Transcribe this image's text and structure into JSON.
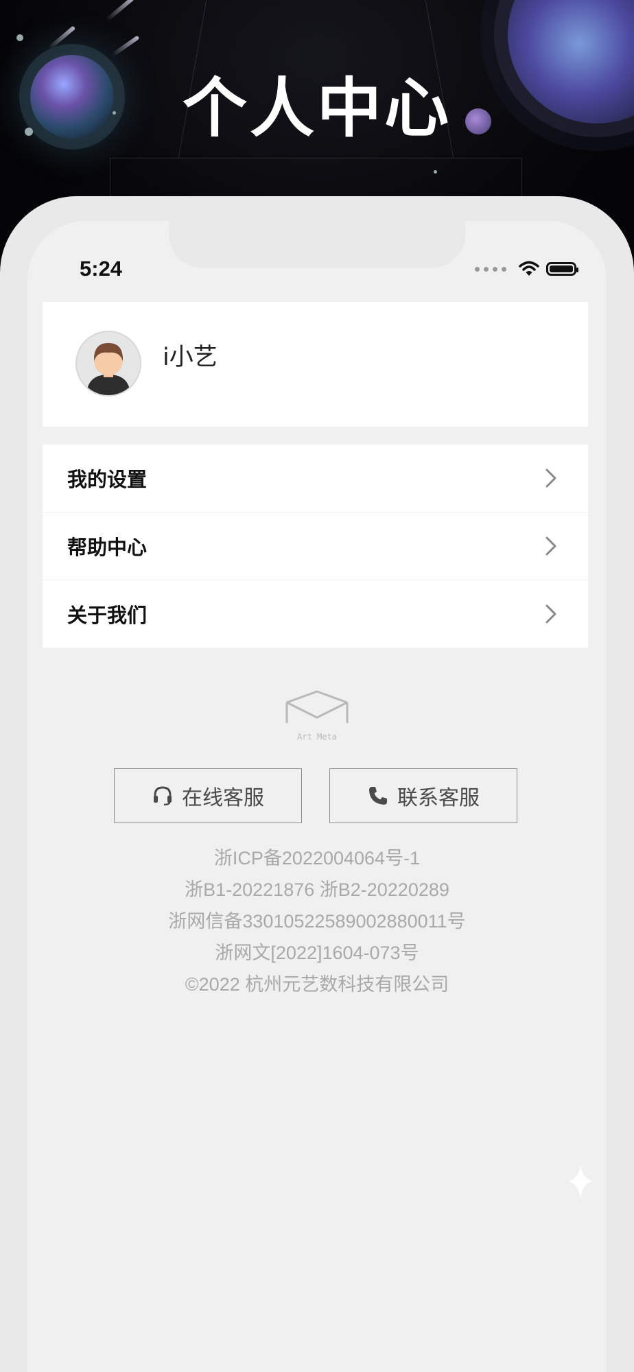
{
  "banner": {
    "title": "个人中心"
  },
  "status_bar": {
    "time": "5:24"
  },
  "profile": {
    "username": "i小艺"
  },
  "menu": {
    "items": [
      {
        "label": "我的设置"
      },
      {
        "label": "帮助中心"
      },
      {
        "label": "关于我们"
      }
    ]
  },
  "logo": {
    "text": "Art Meta"
  },
  "buttons": {
    "online_service": "在线客服",
    "contact_service": "联系客服"
  },
  "footer": {
    "lines": [
      "浙ICP备2022004064号-1",
      "浙B1-20221876 浙B2-20220289",
      "浙网信备33010522589002880011号",
      "浙网文[2022]1604-073号",
      "©2022 杭州元艺数科技有限公司"
    ]
  },
  "icons": {
    "headset": "headset-icon",
    "phone": "phone-icon",
    "chevron": "chevron-right-icon",
    "wifi": "wifi-icon",
    "battery": "battery-icon"
  },
  "colors": {
    "banner_bg": "#050508",
    "screen_bg": "#f0f0f0",
    "card_bg": "#ffffff",
    "footer_text": "#a9a9a9",
    "button_border": "#8a8a8a"
  }
}
